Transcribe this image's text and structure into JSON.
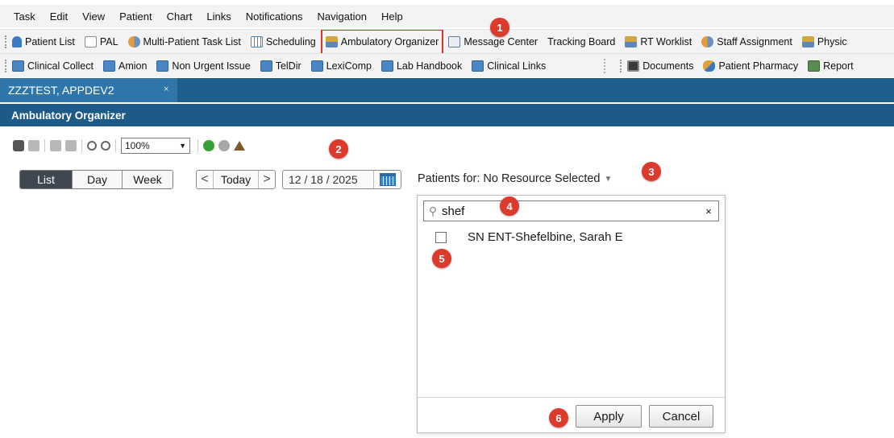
{
  "menu": [
    "Task",
    "Edit",
    "View",
    "Patient",
    "Chart",
    "Links",
    "Notifications",
    "Navigation",
    "Help"
  ],
  "toolbar1": [
    {
      "label": "Patient List",
      "icon": "person-icon"
    },
    {
      "label": "PAL",
      "icon": "document-icon"
    },
    {
      "label": "Multi-Patient Task List",
      "icon": "people-icon"
    },
    {
      "label": "Scheduling",
      "icon": "grid-icon"
    },
    {
      "label": "Ambulatory Organizer",
      "icon": "organizer-icon"
    },
    {
      "label": "Message Center",
      "icon": "message-icon"
    },
    {
      "label": "Tracking Board",
      "icon": ""
    },
    {
      "label": "RT Worklist",
      "icon": "organizer-icon"
    },
    {
      "label": "Staff Assignment",
      "icon": "people-icon"
    },
    {
      "label": "Physic",
      "icon": "organizer-icon"
    }
  ],
  "toolbar2": [
    {
      "label": "Clinical Collect"
    },
    {
      "label": "Amion"
    },
    {
      "label": "Non Urgent Issue"
    },
    {
      "label": "TelDir"
    },
    {
      "label": "LexiComp"
    },
    {
      "label": "Lab Handbook"
    },
    {
      "label": "Clinical Links"
    }
  ],
  "toolbar2_right": [
    {
      "label": "Documents",
      "icon": "film-icon"
    },
    {
      "label": "Patient Pharmacy",
      "icon": "pharmacy-icon"
    },
    {
      "label": "Report",
      "icon": "report-icon"
    }
  ],
  "patient_tab": {
    "name": "ZZZTEST, APPDEV2",
    "close": "×"
  },
  "page_title": "Ambulatory Organizer",
  "zoom": "100%",
  "view_modes": {
    "list": "List",
    "day": "Day",
    "week": "Week"
  },
  "nav": {
    "prev": "<",
    "today": "Today",
    "next": ">"
  },
  "date": "12 / 18 / 2025",
  "patients_for": "Patients for: No Resource Selected",
  "resource_popup": {
    "search_value": "shef",
    "clear": "×",
    "options": [
      {
        "label": "SN ENT-Shefelbine, Sarah E",
        "checked": false
      }
    ],
    "apply": "Apply",
    "cancel": "Cancel"
  },
  "step_badges": [
    "1",
    "2",
    "3",
    "4",
    "5",
    "6"
  ],
  "colors": {
    "header_blue": "#1c5a88",
    "tab_blue": "#2f76aa",
    "badge_red": "#dd3a2e",
    "highlight_red": "#d9342b"
  }
}
